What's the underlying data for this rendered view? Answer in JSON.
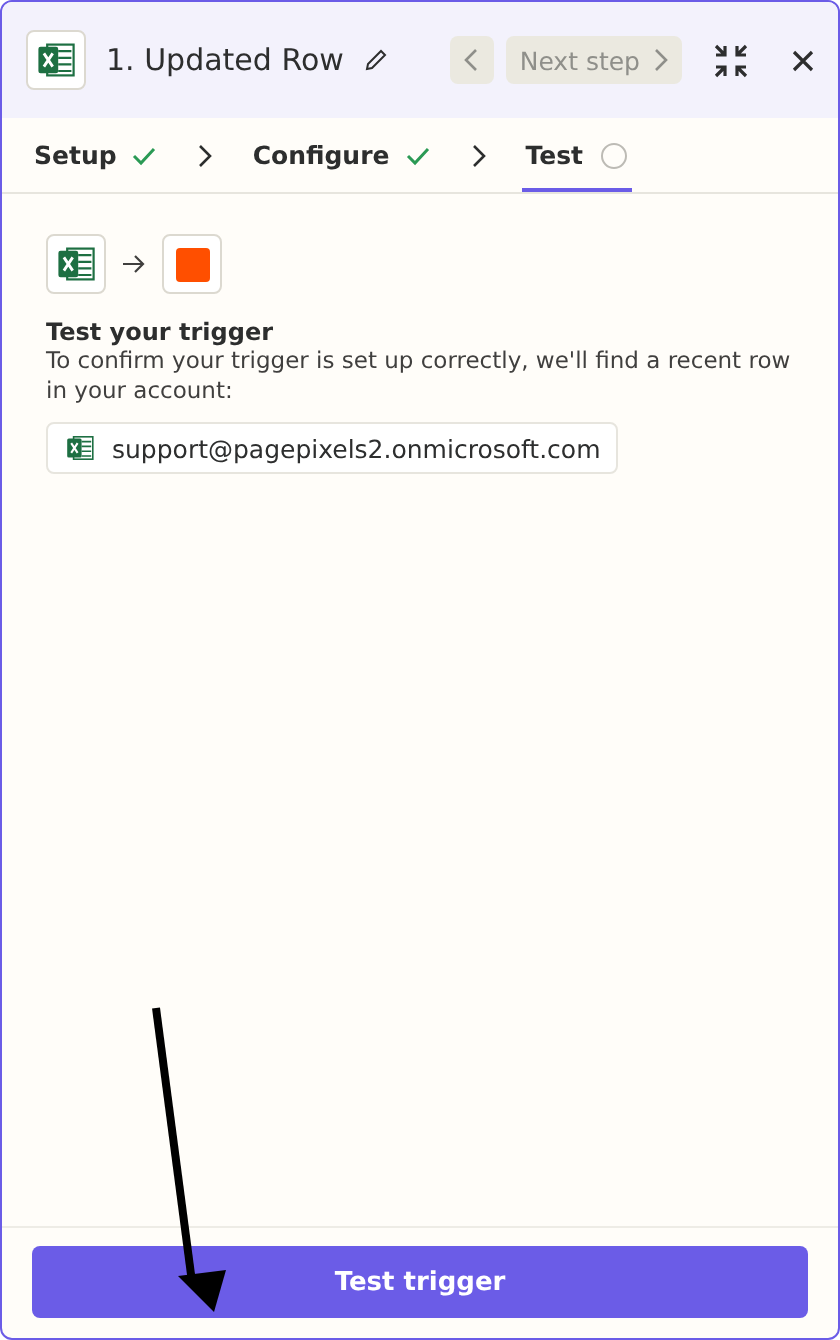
{
  "header": {
    "title": "1. Updated Row",
    "previous_disabled": true,
    "next_label": "Next step",
    "next_disabled": true
  },
  "steps": [
    {
      "label": "Setup",
      "completed": true,
      "selected": false
    },
    {
      "label": "Configure",
      "completed": true,
      "selected": false
    },
    {
      "label": "Test",
      "completed": false,
      "selected": true
    }
  ],
  "content": {
    "heading": "Test your trigger",
    "description": "To confirm your trigger is set up correctly, we'll find a recent row in your account:",
    "account": "support@pagepixels2.onmicrosoft.com"
  },
  "footer": {
    "button": "Test trigger"
  }
}
